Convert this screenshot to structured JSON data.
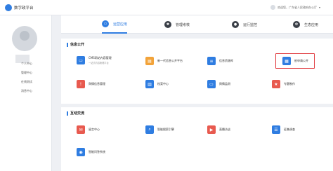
{
  "header": {
    "app_title": "数字政平台",
    "user_text": "欢迎您，广东省人民政府办公厅"
  },
  "sidebar": {
    "items": [
      "个人中心",
      "管理中心",
      "在线测试",
      "消息中心"
    ]
  },
  "tabs": [
    {
      "label": "运营应用",
      "icon": "monitor-icon",
      "active": true
    },
    {
      "label": "管理考核",
      "icon": "gear-icon",
      "active": false
    },
    {
      "label": "运行监控",
      "icon": "location-icon",
      "active": false
    },
    {
      "label": "生态应用",
      "icon": "leaf-icon",
      "active": false
    }
  ],
  "sections": [
    {
      "title": "信息公开",
      "tiles": [
        {
          "label": "CMS网站内容管理",
          "sub": "一站式内容管理平台",
          "icon": "monitor-icon",
          "color": "blue"
        },
        {
          "label": "新一代信息公开平台",
          "sub": "",
          "icon": "folder-icon",
          "color": "orange"
        },
        {
          "label": "信息资源库",
          "sub": "",
          "icon": "database-icon",
          "color": "blue"
        },
        {
          "label": "依申请公开",
          "sub": "",
          "icon": "document-icon",
          "color": "blue",
          "highlighted": true
        },
        {
          "label": "舆情信息管理",
          "sub": "",
          "icon": "alert-icon",
          "color": "red"
        },
        {
          "label": "档案中心",
          "sub": "",
          "icon": "archive-icon",
          "color": "blue"
        },
        {
          "label": "舆情监测",
          "sub": "",
          "icon": "monitor-icon",
          "color": "blue"
        },
        {
          "label": "专题制作",
          "sub": "",
          "icon": "star-icon",
          "color": "red"
        }
      ]
    },
    {
      "title": "互动交流",
      "tiles": [
        {
          "label": "留言中心",
          "sub": "",
          "icon": "message-icon",
          "color": "red"
        },
        {
          "label": "智能搜索引擎",
          "sub": "",
          "icon": "search-icon",
          "color": "blue"
        },
        {
          "label": "直播访谈",
          "sub": "",
          "icon": "video-icon",
          "color": "red"
        },
        {
          "label": "征集调查",
          "sub": "",
          "icon": "survey-icon",
          "color": "blue"
        },
        {
          "label": "智能问答系统",
          "sub": "",
          "icon": "robot-icon",
          "color": "blue"
        }
      ]
    }
  ]
}
